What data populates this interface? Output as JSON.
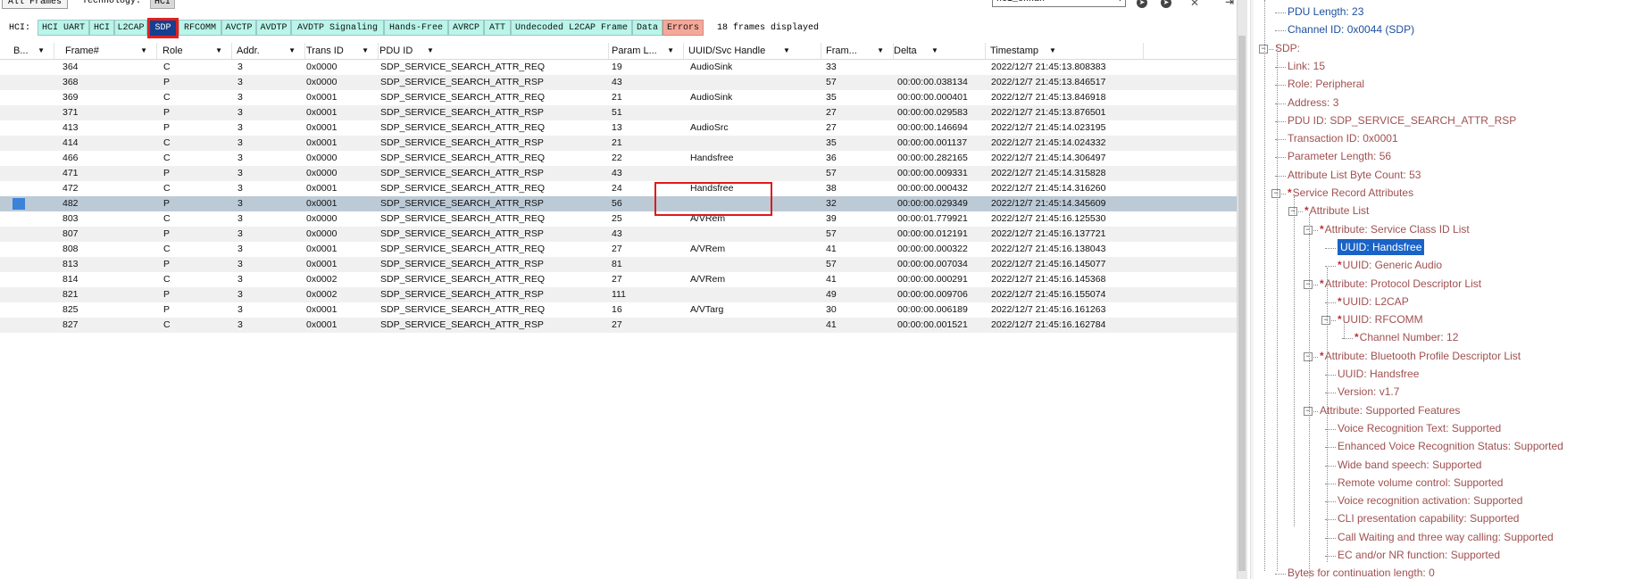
{
  "toolbar": {
    "all_frames_label": "All Frames",
    "technology_label": "Technology:",
    "technology_value": "HCI",
    "search_value": "hci_ennan"
  },
  "filter": {
    "label": "HCI:",
    "chips": [
      "HCI UART",
      "HCI",
      "L2CAP",
      "SDP",
      "RFCOMM",
      "AVCTP",
      "AVDTP",
      "AVDTP Signaling",
      "Hands-Free",
      "AVRCP",
      "ATT",
      "Undecoded L2CAP Frame",
      "Data",
      "Errors"
    ],
    "selected": "SDP",
    "frames_displayed": "18 frames displayed"
  },
  "table": {
    "columns": [
      "B...",
      "Frame#",
      "Role",
      "Addr.",
      "Trans ID",
      "PDU ID",
      "Param L...",
      "UUID/Svc Handle",
      "Fram...",
      "Delta",
      "Timestamp"
    ],
    "rows": [
      [
        "364",
        "C",
        "3",
        "0x0000",
        "SDP_SERVICE_SEARCH_ATTR_REQ",
        "19",
        "AudioSink",
        "33",
        "",
        "2022/12/7 21:45:13.808383"
      ],
      [
        "368",
        "P",
        "3",
        "0x0000",
        "SDP_SERVICE_SEARCH_ATTR_RSP",
        "43",
        "",
        "57",
        "00:00:00.038134",
        "2022/12/7 21:45:13.846517"
      ],
      [
        "369",
        "C",
        "3",
        "0x0001",
        "SDP_SERVICE_SEARCH_ATTR_REQ",
        "21",
        "AudioSink",
        "35",
        "00:00:00.000401",
        "2022/12/7 21:45:13.846918"
      ],
      [
        "371",
        "P",
        "3",
        "0x0001",
        "SDP_SERVICE_SEARCH_ATTR_RSP",
        "51",
        "",
        "27",
        "00:00:00.029583",
        "2022/12/7 21:45:13.876501"
      ],
      [
        "413",
        "P",
        "3",
        "0x0001",
        "SDP_SERVICE_SEARCH_ATTR_REQ",
        "13",
        "AudioSrc",
        "27",
        "00:00:00.146694",
        "2022/12/7 21:45:14.023195"
      ],
      [
        "414",
        "C",
        "3",
        "0x0001",
        "SDP_SERVICE_SEARCH_ATTR_RSP",
        "21",
        "",
        "35",
        "00:00:00.001137",
        "2022/12/7 21:45:14.024332"
      ],
      [
        "466",
        "C",
        "3",
        "0x0000",
        "SDP_SERVICE_SEARCH_ATTR_REQ",
        "22",
        "Handsfree",
        "36",
        "00:00:00.282165",
        "2022/12/7 21:45:14.306497"
      ],
      [
        "471",
        "P",
        "3",
        "0x0000",
        "SDP_SERVICE_SEARCH_ATTR_RSP",
        "43",
        "",
        "57",
        "00:00:00.009331",
        "2022/12/7 21:45:14.315828"
      ],
      [
        "472",
        "C",
        "3",
        "0x0001",
        "SDP_SERVICE_SEARCH_ATTR_REQ",
        "24",
        "Handsfree",
        "38",
        "00:00:00.000432",
        "2022/12/7 21:45:14.316260"
      ],
      [
        "482",
        "P",
        "3",
        "0x0001",
        "SDP_SERVICE_SEARCH_ATTR_RSP",
        "56",
        "",
        "32",
        "00:00:00.029349",
        "2022/12/7 21:45:14.345609"
      ],
      [
        "803",
        "C",
        "3",
        "0x0000",
        "SDP_SERVICE_SEARCH_ATTR_REQ",
        "25",
        "A/VRem",
        "39",
        "00:00:01.779921",
        "2022/12/7 21:45:16.125530"
      ],
      [
        "807",
        "P",
        "3",
        "0x0000",
        "SDP_SERVICE_SEARCH_ATTR_RSP",
        "43",
        "",
        "57",
        "00:00:00.012191",
        "2022/12/7 21:45:16.137721"
      ],
      [
        "808",
        "C",
        "3",
        "0x0001",
        "SDP_SERVICE_SEARCH_ATTR_REQ",
        "27",
        "A/VRem",
        "41",
        "00:00:00.000322",
        "2022/12/7 21:45:16.138043"
      ],
      [
        "813",
        "P",
        "3",
        "0x0001",
        "SDP_SERVICE_SEARCH_ATTR_RSP",
        "81",
        "",
        "57",
        "00:00:00.007034",
        "2022/12/7 21:45:16.145077"
      ],
      [
        "814",
        "C",
        "3",
        "0x0002",
        "SDP_SERVICE_SEARCH_ATTR_REQ",
        "27",
        "A/VRem",
        "41",
        "00:00:00.000291",
        "2022/12/7 21:45:16.145368"
      ],
      [
        "821",
        "P",
        "3",
        "0x0002",
        "SDP_SERVICE_SEARCH_ATTR_RSP",
        "111",
        "",
        "49",
        "00:00:00.009706",
        "2022/12/7 21:45:16.155074"
      ],
      [
        "825",
        "P",
        "3",
        "0x0001",
        "SDP_SERVICE_SEARCH_ATTR_REQ",
        "16",
        "A/VTarg",
        "30",
        "00:00:00.006189",
        "2022/12/7 21:45:16.161263"
      ],
      [
        "827",
        "C",
        "3",
        "0x0001",
        "SDP_SERVICE_SEARCH_ATTR_RSP",
        "27",
        "",
        "41",
        "00:00:00.001521",
        "2022/12/7 21:45:16.162784"
      ]
    ],
    "selected_frame": "482"
  },
  "tree": {
    "nodes": [
      {
        "text": "PDU Length: 23",
        "color": "blue"
      },
      {
        "text": "Channel ID: 0x0044  (SDP)",
        "color": "blue"
      },
      {
        "text": "SDP:"
      },
      {
        "text": "Link: 15"
      },
      {
        "text": "Role: Peripheral"
      },
      {
        "text": "Address: 3"
      },
      {
        "text": "PDU ID: SDP_SERVICE_SEARCH_ATTR_RSP"
      },
      {
        "text": "Transaction ID: 0x0001"
      },
      {
        "text": "Parameter Length: 56"
      },
      {
        "text": "Attribute List Byte Count: 53"
      },
      {
        "text": "Service Record Attributes",
        "star": true
      },
      {
        "text": "Attribute List",
        "star": true
      },
      {
        "text": "Attribute: Service Class ID List",
        "star": true
      },
      {
        "text": "UUID: Handsfree",
        "selected": true
      },
      {
        "text": "UUID: Generic Audio",
        "star": true
      },
      {
        "text": "Attribute: Protocol Descriptor List",
        "star": true
      },
      {
        "text": "UUID: L2CAP",
        "star": true
      },
      {
        "text": "UUID: RFCOMM",
        "star": true
      },
      {
        "text": "Channel Number: 12",
        "star": true
      },
      {
        "text": "Attribute: Bluetooth Profile Descriptor List",
        "star": true
      },
      {
        "text": "UUID: Handsfree"
      },
      {
        "text": "Version: v1.7"
      },
      {
        "text": "Attribute: Supported Features"
      },
      {
        "text": "Voice Recognition Text: Supported"
      },
      {
        "text": "Enhanced Voice Recognition Status: Supported"
      },
      {
        "text": "Wide band speech: Supported"
      },
      {
        "text": "Remote volume control: Supported"
      },
      {
        "text": "Voice recognition activation: Supported"
      },
      {
        "text": "CLI presentation capability: Supported"
      },
      {
        "text": "Call Waiting and three way calling: Supported"
      },
      {
        "text": "EC and/or NR function: Supported"
      },
      {
        "text": "Bytes for continuation length: 0"
      }
    ]
  },
  "colors": {
    "chip_bg": "#b9f5e9",
    "chip_selected_bg": "#153f8f",
    "errors_chip_bg": "#f5a89a",
    "selected_row_bg": "#bccad6",
    "tree_text": "#a05050",
    "tree_blue_text": "#1d4f9e",
    "tree_selected_bg": "#1a63c6",
    "annotation_red": "#e01818"
  }
}
